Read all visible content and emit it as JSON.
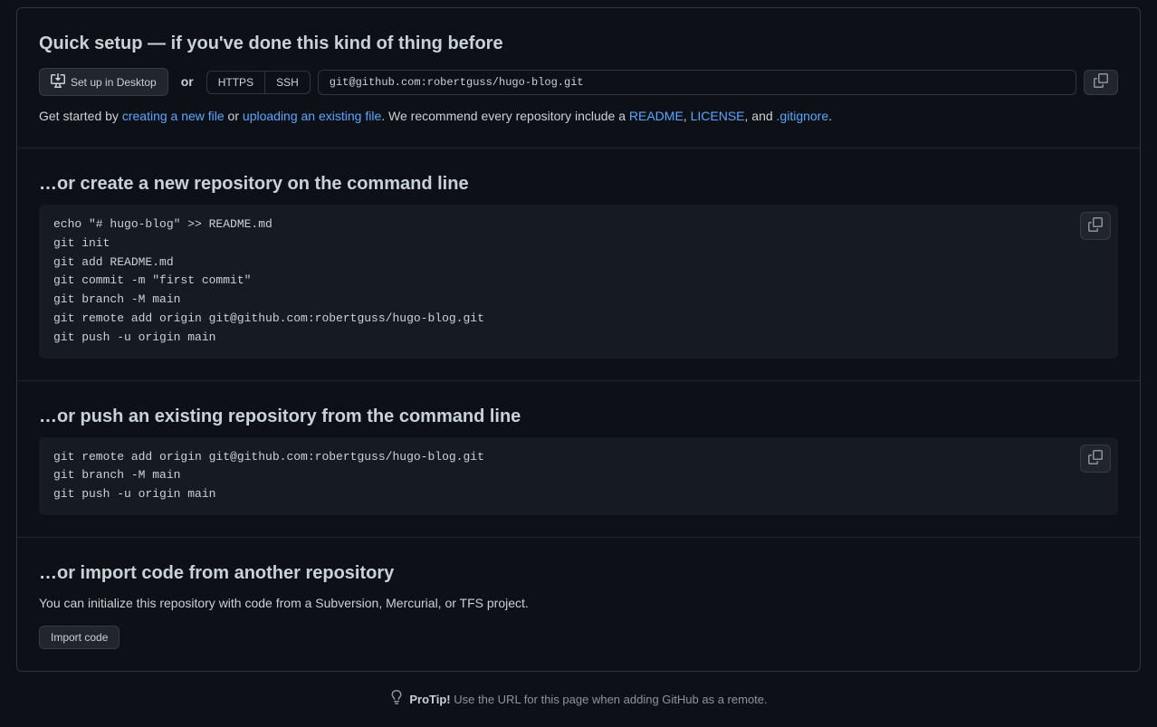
{
  "quickSetup": {
    "heading": "Quick setup — if you've done this kind of thing before",
    "setupDesktopLabel": "Set up in Desktop",
    "orLabel": "or",
    "httpsLabel": "HTTPS",
    "sshLabel": "SSH",
    "cloneUrl": "git@github.com:robertguss/hugo-blog.git",
    "getStarted": {
      "prefix": "Get started by ",
      "createFile": "creating a new file",
      "or": " or ",
      "uploadFile": "uploading an existing file",
      "recommend": ". We recommend every repository include a ",
      "readme": "README",
      "comma1": ", ",
      "license": "LICENSE",
      "and": ", and ",
      "gitignore": ".gitignore",
      "period": "."
    }
  },
  "createRepo": {
    "heading": "…or create a new repository on the command line",
    "commands": "echo \"# hugo-blog\" >> README.md\ngit init\ngit add README.md\ngit commit -m \"first commit\"\ngit branch -M main\ngit remote add origin git@github.com:robertguss/hugo-blog.git\ngit push -u origin main"
  },
  "pushRepo": {
    "heading": "…or push an existing repository from the command line",
    "commands": "git remote add origin git@github.com:robertguss/hugo-blog.git\ngit branch -M main\ngit push -u origin main"
  },
  "importRepo": {
    "heading": "…or import code from another repository",
    "description": "You can initialize this repository with code from a Subversion, Mercurial, or TFS project.",
    "buttonLabel": "Import code"
  },
  "protip": {
    "label": "ProTip!",
    "text": " Use the URL for this page when adding GitHub as a remote."
  }
}
